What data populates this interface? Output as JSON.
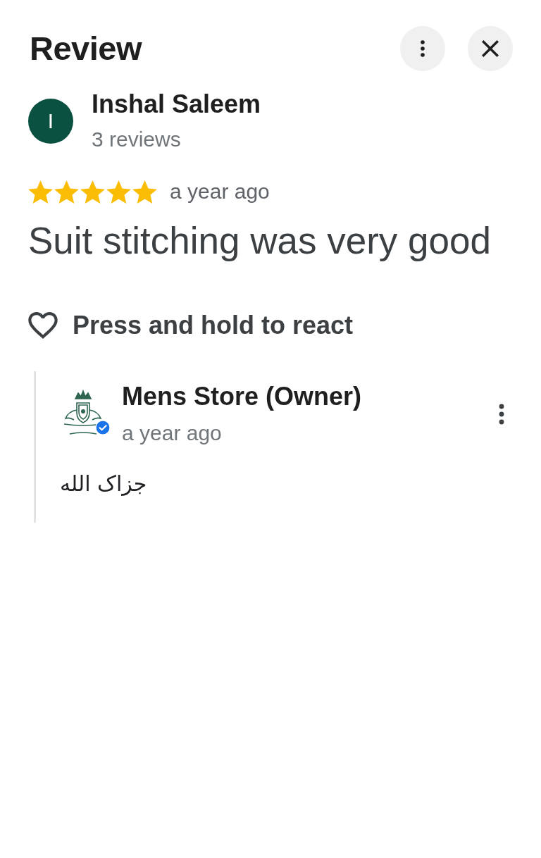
{
  "header": {
    "title": "Review"
  },
  "reviewer": {
    "initial": "I",
    "name": "Inshal Saleem",
    "review_count": "3 reviews"
  },
  "review": {
    "stars": 5,
    "time": "a year ago",
    "text": "Suit stitching was very good"
  },
  "react": {
    "label": "Press and hold to react"
  },
  "owner_reply": {
    "name": "Mens Store (Owner)",
    "verified": true,
    "time": "a year ago",
    "text": "جزاک الله"
  }
}
